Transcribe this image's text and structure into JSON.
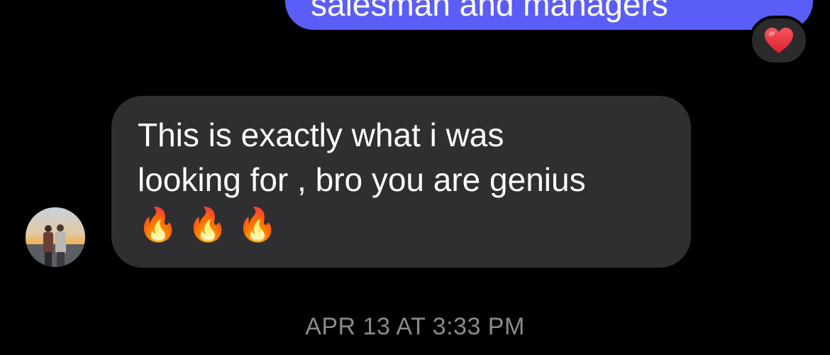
{
  "sent_message": {
    "text": "salesman and managers",
    "reaction": "heart-reaction",
    "bubble_color": "#5b5ef6"
  },
  "received_message": {
    "text": "This is exactly what i was\nlooking for , bro you are genius\n🔥 🔥 🔥",
    "bubble_color": "#2f2f31",
    "sender_avatar": "avatar-photo"
  },
  "timestamp": "APR 13 AT 3:33 PM",
  "colors": {
    "background": "#000000",
    "timestamp": "#8a8a8e",
    "heart": "#e8313d"
  }
}
